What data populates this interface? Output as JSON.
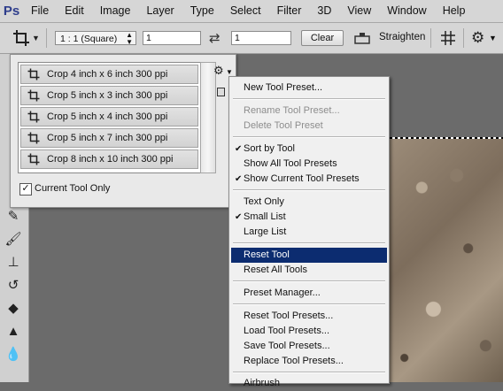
{
  "app": {
    "logo": "Ps"
  },
  "menubar": [
    "File",
    "Edit",
    "Image",
    "Layer",
    "Type",
    "Select",
    "Filter",
    "3D",
    "View",
    "Window",
    "Help"
  ],
  "options": {
    "ratio": "1 : 1 (Square)",
    "width": "1",
    "height": "1",
    "clear_label": "Clear",
    "straighten_label": "Straighten"
  },
  "presets": {
    "items": [
      "Crop 4 inch x 6 inch 300 ppi",
      "Crop 5 inch x 3 inch 300 ppi",
      "Crop 5 inch x 4 inch 300 ppi",
      "Crop 5 inch x 7 inch 300 ppi",
      "Crop 8 inch x 10 inch 300 ppi"
    ],
    "current_tool_only_label": "Current Tool Only",
    "current_tool_only_checked": true
  },
  "context_menu": {
    "items": [
      {
        "label": "New Tool Preset...",
        "enabled": true,
        "checked": false
      },
      {
        "label": "Rename Tool Preset...",
        "enabled": false,
        "checked": false
      },
      {
        "label": "Delete Tool Preset",
        "enabled": false,
        "checked": false
      },
      {
        "label": "Sort by Tool",
        "enabled": true,
        "checked": true
      },
      {
        "label": "Show All Tool Presets",
        "enabled": true,
        "checked": false
      },
      {
        "label": "Show Current Tool Presets",
        "enabled": true,
        "checked": true
      },
      {
        "label": "Text Only",
        "enabled": true,
        "checked": false
      },
      {
        "label": "Small List",
        "enabled": true,
        "checked": true
      },
      {
        "label": "Large List",
        "enabled": true,
        "checked": false
      },
      {
        "label": "Reset Tool",
        "enabled": true,
        "checked": false,
        "highlighted": true
      },
      {
        "label": "Reset All Tools",
        "enabled": true,
        "checked": false
      },
      {
        "label": "Preset Manager...",
        "enabled": true,
        "checked": false
      },
      {
        "label": "Reset Tool Presets...",
        "enabled": true,
        "checked": false
      },
      {
        "label": "Load Tool Presets...",
        "enabled": true,
        "checked": false
      },
      {
        "label": "Save Tool Presets...",
        "enabled": true,
        "checked": false
      },
      {
        "label": "Replace Tool Presets...",
        "enabled": true,
        "checked": false
      },
      {
        "label": "Airbrush",
        "enabled": true,
        "checked": false
      }
    ]
  },
  "colors": {
    "highlight": "#0c2c70",
    "menubar": "#d6d6d6",
    "workspace": "#6b6b6b"
  }
}
